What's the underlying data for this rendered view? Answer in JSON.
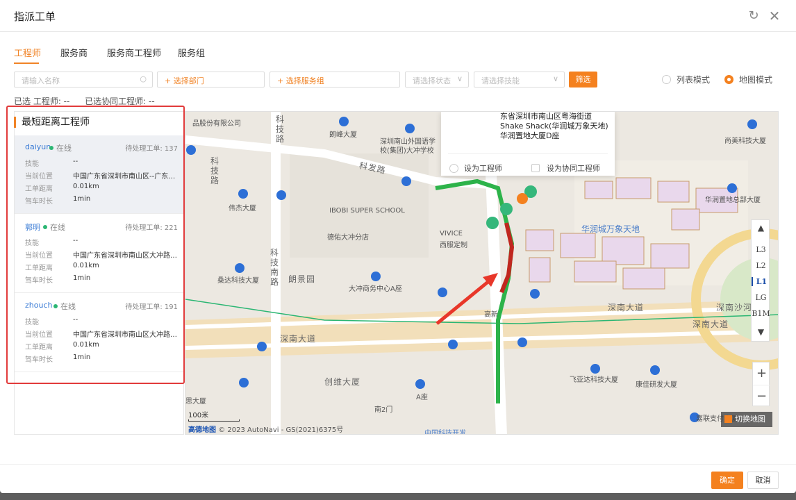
{
  "dialog": {
    "title": "指派工单"
  },
  "tabs": [
    {
      "label": "工程师",
      "active": true
    },
    {
      "label": "服务商",
      "active": false
    },
    {
      "label": "服务商工程师",
      "active": false
    },
    {
      "label": "服务组",
      "active": false
    }
  ],
  "filters": {
    "search_placeholder": "请输入名称",
    "department": "+ 选择部门",
    "service_group": "+ 选择服务组",
    "status_placeholder": "请选择状态",
    "skill_placeholder": "请选择技能",
    "filter_button": "筛选"
  },
  "modes": {
    "list": "列表模式",
    "map": "地图模式",
    "selected": "map"
  },
  "selected": {
    "engineer": "已选 工程师: --",
    "co_engineer": "已选协同工程师: --"
  },
  "panel": {
    "title": "最短距离工程师"
  },
  "field_labels": {
    "skill": "技能",
    "location": "当前位置",
    "distance": "工单距离",
    "drive_time": "驾车时长"
  },
  "engineers": [
    {
      "name": "daiyun",
      "status": "在线",
      "pending": "待处理工单: 137",
      "skill": "--",
      "location": "中国广东省深圳市南山区--广东省深圳市南山区",
      "distance": "0.01km",
      "drive_time": "1min"
    },
    {
      "name": "郭明",
      "status": "在线",
      "pending": "待处理工单: 221",
      "skill": "--",
      "location": "中国广东省深圳市南山区大冲路华润置地大厦",
      "distance": "0.01km",
      "drive_time": "1min"
    },
    {
      "name": "zhouch",
      "status": "在线",
      "pending": "待处理工单: 191",
      "skill": "--",
      "location": "中国广东省深圳市南山区大冲路华润置地大厦",
      "distance": "0.01km",
      "drive_time": "1min"
    }
  ],
  "map": {
    "popup": {
      "address": "东省深圳市南山区粤海街道 Shake Shack(华润城万象天地)华润置地大厦D座",
      "set_engineer": "设为工程师",
      "set_co_engineer": "设为协同工程师"
    },
    "labels": {
      "l1": "品股份有限公司",
      "l2": "朗峰大厦",
      "l3": "深圳南山外国语学",
      "l3b": "校(集团)大冲学校",
      "l4": "尚美科技大厦",
      "l5": "科发路",
      "l6": "伟杰大厦",
      "l7": "IBOBI SUPER SCHOOL",
      "l8": "德佑大冲分店",
      "l9": "VIVICE",
      "l9b": "西服定制",
      "l10": "华润城万象天地",
      "l11": "华润置地总部大厦",
      "l12": "桑达科技大厦",
      "l13": "朗景园",
      "l14": "大冲商务中心A座",
      "l15": "深南大道",
      "l16": "深南沙河",
      "l17": "深南大道",
      "l18": "深南大道",
      "l19": "创维大厦",
      "l20": "飞亚达科技大厦",
      "l21": "康佳研发大厦",
      "l22": "思大厦",
      "l23": "嘉联支付大厦",
      "l24": "科技路",
      "l25": "科技南路",
      "l26": "高新",
      "l27": "南2门",
      "l28": "中国科技开发",
      "l29": "A座",
      "l30": "科技路"
    },
    "floors": [
      "L3",
      "L2",
      "L1",
      "LG",
      "B1M"
    ],
    "active_floor": "L1",
    "zoom_in": "+",
    "zoom_out": "−",
    "switch_label": "切换地图",
    "scale": "100米",
    "attribution_brand": "高德地图",
    "attribution_text": "© 2023 AutoNavi - GS(2021)6375号"
  },
  "footer": {
    "ok": "确定",
    "cancel": "取消"
  },
  "colors": {
    "accent": "#f4811f",
    "link": "#3a7bd5",
    "online": "#2bb673",
    "highlight": "#e23b3b"
  },
  "icons": {
    "refresh": "refresh-icon",
    "close": "close-icon",
    "search": "search-icon",
    "chevron": "chevron-down-icon"
  }
}
